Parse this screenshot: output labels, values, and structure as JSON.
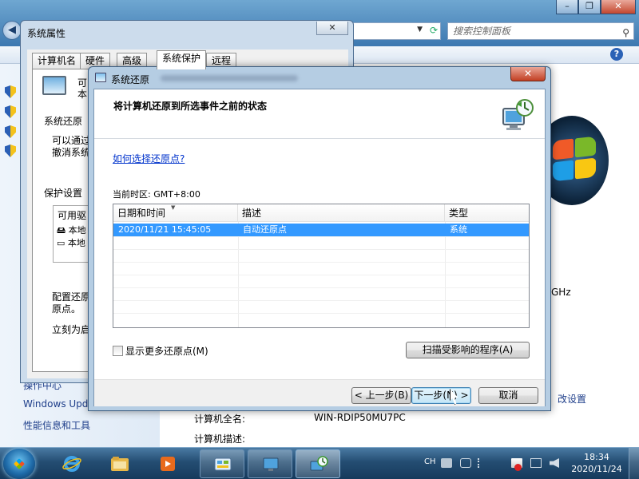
{
  "control_panel": {
    "search_placeholder": "搜索控制面板",
    "help": "?",
    "see_also": [
      "操作中心",
      "Windows Update",
      "性能信息和工具"
    ],
    "change_settings": "改设置",
    "ghz_fragment": "GHz",
    "full_name_label": "计算机全名:",
    "full_name_value": "WIN-RDIP50MU7PC",
    "description_label": "计算机描述:"
  },
  "system_properties": {
    "title": "系统属性",
    "tabs": [
      "计算机名",
      "硬件",
      "高级",
      "系统保护",
      "远程"
    ],
    "active_tab": 3,
    "intro_fragment_1": "可",
    "intro_fragment_2": "本",
    "section_restore": "系统还原",
    "restore_text_1": "可以通过",
    "restore_text_2": "撤消系统",
    "section_protection": "保护设置",
    "list_header": "可用驱",
    "drives": [
      "本地",
      "本地"
    ],
    "configure_text_1": "配置还原",
    "configure_text_2": "原点。",
    "create_text": "立刻为启"
  },
  "system_restore": {
    "title": "系统还原",
    "heading": "将计算机还原到所选事件之前的状态",
    "help_link": "如何选择还原点?",
    "timezone": "当前时区: GMT+8:00",
    "columns": [
      "日期和时间",
      "描述",
      "类型"
    ],
    "rows": [
      {
        "datetime": "2020/11/21 15:45:05",
        "description": "自动还原点",
        "type": "系统"
      }
    ],
    "show_more": "显示更多还原点(M)",
    "scan_button": "扫描受影响的程序(A)",
    "back_button": "< 上一步(B)",
    "next_button": "下一步(N) >",
    "cancel_button": "取消"
  },
  "taskbar": {
    "lang": "CH",
    "time": "18:34",
    "date": "2020/11/24"
  },
  "colors": {
    "selection": "#3399ff",
    "link": "#0033cc",
    "taskbar": "#244d72"
  }
}
